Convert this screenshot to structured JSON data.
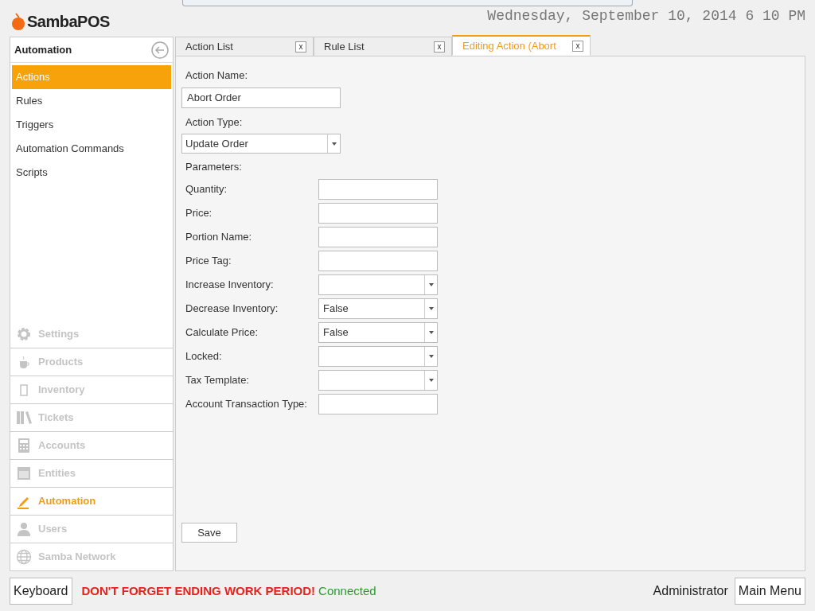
{
  "logo": "SambaPOS",
  "datetime": "Wednesday, September 10, 2014 6 10 PM",
  "sidebar": {
    "title": "Automation",
    "items": [
      {
        "label": "Actions",
        "selected": true
      },
      {
        "label": "Rules",
        "selected": false
      },
      {
        "label": "Triggers",
        "selected": false
      },
      {
        "label": "Automation Commands",
        "selected": false
      },
      {
        "label": "Scripts",
        "selected": false
      }
    ],
    "modules": [
      {
        "label": "Settings",
        "kind": "gear",
        "selected": false
      },
      {
        "label": "Products",
        "kind": "cup",
        "selected": false
      },
      {
        "label": "Inventory",
        "kind": "rect",
        "selected": false
      },
      {
        "label": "Tickets",
        "kind": "books",
        "selected": false
      },
      {
        "label": "Accounts",
        "kind": "calculator",
        "selected": false
      },
      {
        "label": "Entities",
        "kind": "grid",
        "selected": false
      },
      {
        "label": "Automation",
        "kind": "pencil",
        "selected": true
      },
      {
        "label": "Users",
        "kind": "user",
        "selected": false
      },
      {
        "label": "Samba Network",
        "kind": "globe",
        "selected": false
      }
    ]
  },
  "tabs": [
    {
      "label": "Action List",
      "close": "x",
      "selected": false
    },
    {
      "label": "Rule List",
      "close": "x",
      "selected": false
    },
    {
      "label": "Editing Action (Abort",
      "close": "x",
      "selected": true
    }
  ],
  "form": {
    "action_name_label": "Action Name:",
    "action_name": "Abort Order",
    "action_type_label": "Action Type:",
    "action_type": "Update Order",
    "parameters_label": "Parameters:",
    "parameters": [
      {
        "label": "Quantity:",
        "kind": "text"
      },
      {
        "label": "Price:",
        "kind": "text"
      },
      {
        "label": "Portion Name:",
        "kind": "text"
      },
      {
        "label": "Price Tag:",
        "kind": "text"
      },
      {
        "label": "Increase Inventory:",
        "kind": "dropdown"
      },
      {
        "label": "Decrease Inventory:",
        "kind": "dropdown",
        "value": "False"
      },
      {
        "label": "Calculate Price:",
        "kind": "dropdown",
        "value": "False"
      },
      {
        "label": "Locked:",
        "kind": "dropdown"
      },
      {
        "label": "Tax Template:",
        "kind": "dropdown"
      },
      {
        "label": "Account Transaction Type:",
        "kind": "text"
      }
    ],
    "save": "Save"
  },
  "footer": {
    "keyboard": "Keyboard",
    "warning": "DON'T FORGET ENDING WORK PERIOD!",
    "status": "Connected",
    "user": "Administrator",
    "main_menu": "Main Menu"
  }
}
